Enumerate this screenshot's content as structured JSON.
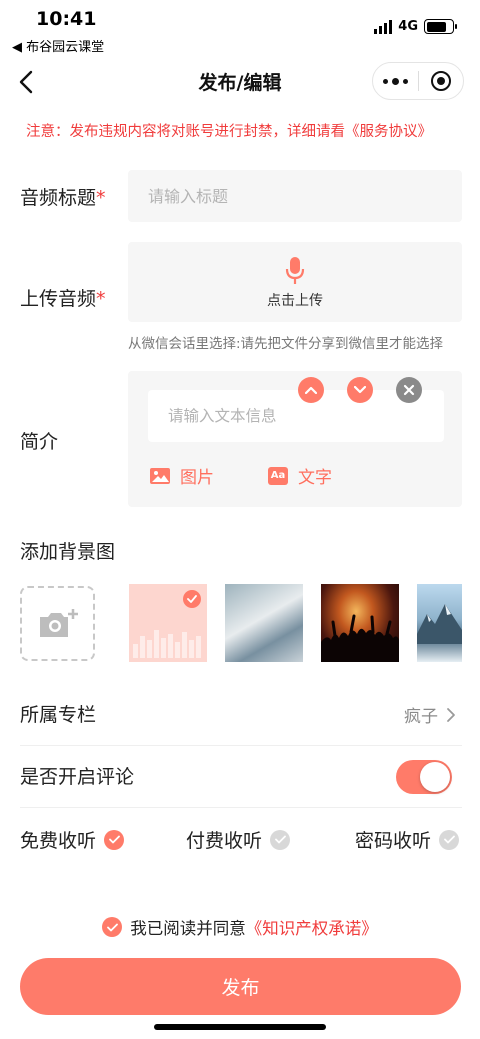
{
  "status_bar": {
    "time": "10:41",
    "back_app": "◀ 布谷园云课堂",
    "network": "4G"
  },
  "nav": {
    "title": "发布/编辑"
  },
  "notice": "注意：发布违规内容将对账号进行封禁，详细请看《服务协议》",
  "form": {
    "title_label": "音频标题",
    "title_placeholder": "请输入标题",
    "upload_label": "上传音频",
    "upload_text": "点击上传",
    "upload_hint": "从微信会话里选择:请先把文件分享到微信里才能选择",
    "intro_label": "简介",
    "intro_placeholder": "请输入文本信息",
    "intro_image_label": "图片",
    "intro_text_label": "文字",
    "text_icon_glyph": "Aa",
    "required_mark": "*"
  },
  "background": {
    "title": "添加背景图",
    "selected_index": 0
  },
  "column": {
    "label": "所属专栏",
    "value": "疯子"
  },
  "comments": {
    "label": "是否开启评论",
    "enabled": true
  },
  "listen_options": [
    {
      "label": "免费收听",
      "selected": true
    },
    {
      "label": "付费收听",
      "selected": false
    },
    {
      "label": "密码收听",
      "selected": false
    }
  ],
  "agreement": {
    "text": "我已阅读并同意",
    "link": "《知识产权承诺》",
    "checked": true
  },
  "publish_button": "发布",
  "colors": {
    "accent": "#ff7b69",
    "warning": "#f03c3c",
    "input_bg": "#f6f6f6"
  }
}
